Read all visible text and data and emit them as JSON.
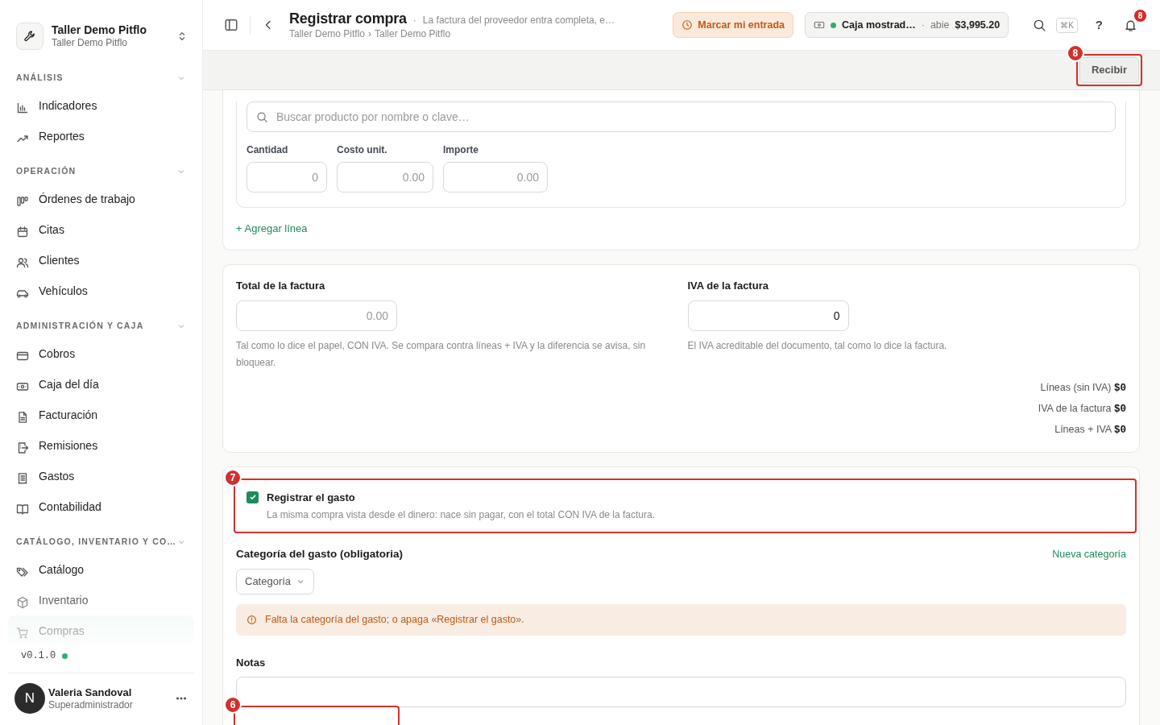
{
  "workspace": {
    "name": "Taller Demo Pitflo",
    "subtitle": "Taller Demo Pitflo"
  },
  "sidebar": {
    "sections": [
      {
        "title": "ANÁLISIS",
        "expanded": true,
        "items": [
          {
            "label": "Indicadores",
            "selected": false
          },
          {
            "label": "Reportes",
            "selected": false
          }
        ]
      },
      {
        "title": "OPERACIÓN",
        "expanded": true,
        "items": [
          {
            "label": "Órdenes de trabajo",
            "selected": false
          },
          {
            "label": "Citas",
            "selected": false
          },
          {
            "label": "Clientes",
            "selected": false
          },
          {
            "label": "Vehículos",
            "selected": false
          }
        ]
      },
      {
        "title": "ADMINISTRACIÓN Y CAJA",
        "expanded": true,
        "items": [
          {
            "label": "Cobros",
            "selected": false
          },
          {
            "label": "Caja del día",
            "selected": false
          },
          {
            "label": "Facturación",
            "selected": false
          },
          {
            "label": "Remisiones",
            "selected": false
          },
          {
            "label": "Gastos",
            "selected": false
          },
          {
            "label": "Contabilidad",
            "selected": false
          }
        ]
      },
      {
        "title": "CATÁLOGO, INVENTARIO Y CO…",
        "expanded": true,
        "items": [
          {
            "label": "Catálogo",
            "selected": false
          },
          {
            "label": "Inventario",
            "selected": false
          },
          {
            "label": "Compras",
            "selected": true
          }
        ]
      }
    ],
    "version": "v0.1.0",
    "version_online": true,
    "user": {
      "initial": "N",
      "name": "Valeria Sandoval",
      "role": "Superadministrador"
    }
  },
  "header": {
    "title": "Registrar compra",
    "separator": "·",
    "subtitle": "La factura del proveedor entra completa, e…",
    "breadcrumb": [
      "Taller Demo Pitflo",
      "Taller Demo Pitflo"
    ],
    "breadcrumb_separator": "›",
    "clock_button": "Marcar mi entrada",
    "register": {
      "name": "Caja mostrad…",
      "open": true,
      "separator": "·",
      "status": "abie",
      "amount": "$3,995.20"
    },
    "shortcut": "⌘K",
    "help": "?",
    "notifications": "8"
  },
  "toolbar": {
    "receive_button": "Recibir",
    "annotation": "8"
  },
  "line_item": {
    "search_placeholder": "Buscar producto por nombre o clave…",
    "fields": [
      {
        "label": "Cantidad",
        "placeholder": "0"
      },
      {
        "label": "Costo unit.",
        "placeholder": "0.00"
      },
      {
        "label": "Importe",
        "placeholder": "0.00"
      }
    ],
    "add_line": "+ Agregar línea"
  },
  "invoice": {
    "total": {
      "label": "Total de la factura",
      "placeholder": "0.00",
      "help": "Tal como lo dice el papel, CON IVA. Se compara contra líneas + IVA y la diferencia se avisa, sin bloquear."
    },
    "tax": {
      "label": "IVA de la factura",
      "value": "0",
      "help": "El IVA acreditable del documento, tal como lo dice la factura."
    },
    "summary": [
      {
        "label": "Líneas (sin IVA)",
        "value": "$0"
      },
      {
        "label": "IVA de la factura",
        "value": "$0"
      },
      {
        "label": "Líneas + IVA",
        "value": "$0"
      }
    ]
  },
  "expense": {
    "toggle": {
      "title": "Registrar el gasto",
      "description": "La misma compra vista desde el dinero: nace sin pagar, con el total CON IVA de la factura.",
      "checked": true,
      "annotation": "7"
    },
    "category_label": "Categoría del gasto (obligatoria)",
    "new_category": "Nueva categoría",
    "category_select": "Categoría",
    "warning": "Falta la categoría del gasto; o apaga «Registrar el gasto».",
    "notes_label": "Notas",
    "notes_annotation": "6"
  }
}
